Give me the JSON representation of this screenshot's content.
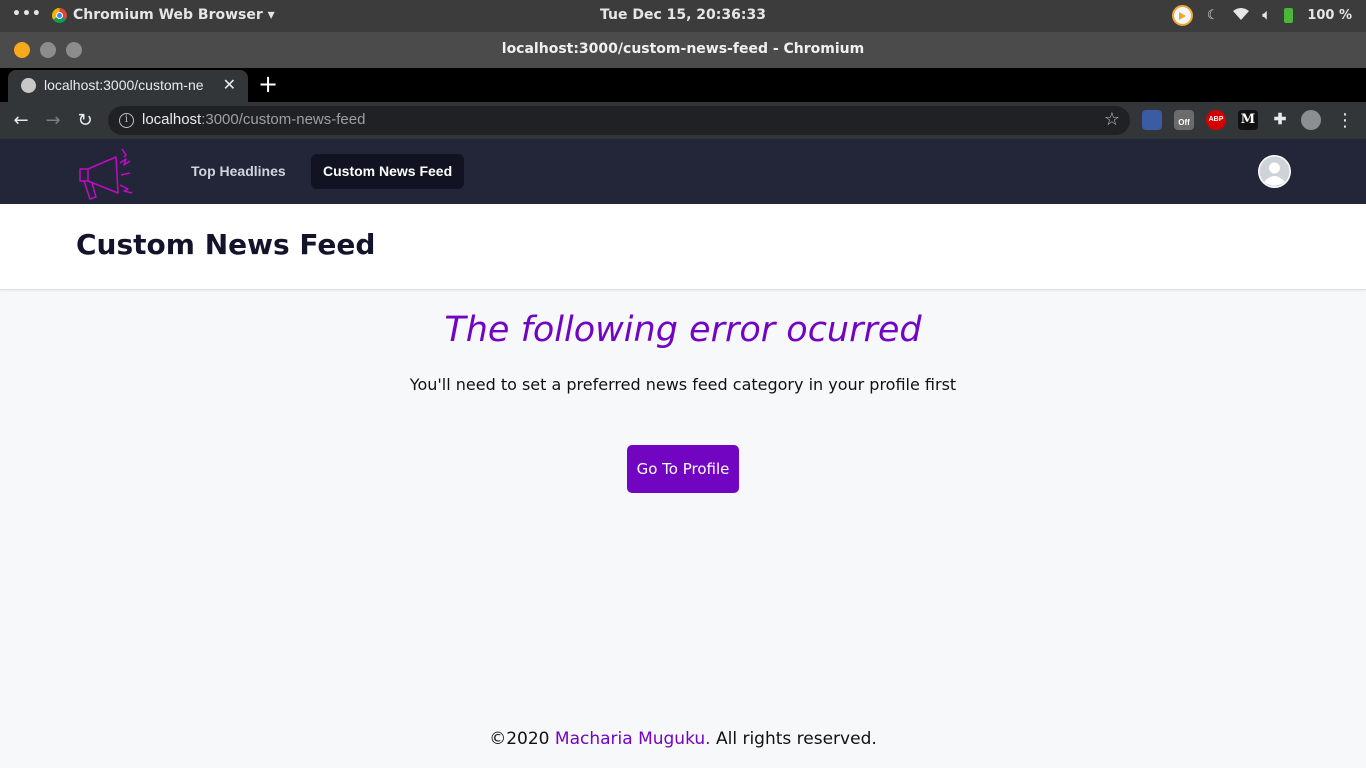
{
  "system": {
    "activities": "•••",
    "app_name": "Chromium Web Browser ▾",
    "clock": "Tue Dec 15, 20:36:33",
    "battery": "100 %"
  },
  "window": {
    "title": "localhost:3000/custom-news-feed - Chromium"
  },
  "tab": {
    "title": "localhost:3000/custom-ne",
    "close": "✕",
    "new_tab": "+"
  },
  "toolbar": {
    "url_host": "localhost",
    "url_path": ":3000/custom-news-feed",
    "back": "←",
    "forward": "→",
    "reload": "↻",
    "star": "☆",
    "menu": "⋮",
    "ext_abp": "ABP",
    "ext_m": "M",
    "ext_off": "Off"
  },
  "nav": {
    "links": [
      "Top Headlines",
      "Custom News Feed"
    ],
    "active_index": 1
  },
  "page": {
    "title": "Custom News Feed"
  },
  "error": {
    "title": "The following error ocurred",
    "message": "You'll need to set a preferred news feed category in your profile first",
    "button": "Go To Profile"
  },
  "footer": {
    "prefix": "©2020 ",
    "author": "Macharia Muguku.",
    "suffix": " All rights reserved."
  },
  "colors": {
    "accent": "#7205c2",
    "navbar": "#232639"
  }
}
